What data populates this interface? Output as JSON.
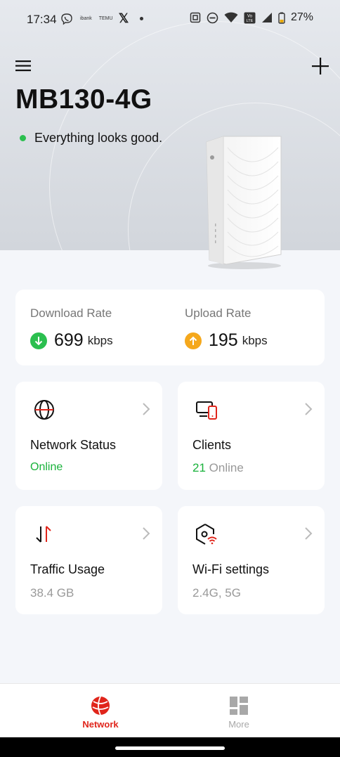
{
  "statusbar": {
    "time": "17:34",
    "notif_ibank": "ibank",
    "notif_temu": "TEMU",
    "notif_x": "𝕏",
    "battery": "27%",
    "volte": "Vo LTE"
  },
  "header": {
    "device_name": "MB130-4G",
    "status_text": "Everything looks good.",
    "status_color": "#2bbf4f"
  },
  "rates": {
    "download": {
      "label": "Download Rate",
      "value": "699",
      "unit": "kbps",
      "color": "#2bbf4f"
    },
    "upload": {
      "label": "Upload Rate",
      "value": "195",
      "unit": "kbps",
      "color": "#f5a81c"
    }
  },
  "tiles": {
    "network_status": {
      "title": "Network Status",
      "sub": "Online",
      "icon": "globe-icon"
    },
    "clients": {
      "title": "Clients",
      "count": "21",
      "sub": "Online",
      "icon": "devices-icon"
    },
    "traffic": {
      "title": "Traffic Usage",
      "sub": "38.4 GB",
      "icon": "traffic-arrows-icon"
    },
    "wifi": {
      "title": "Wi-Fi settings",
      "sub": "2.4G, 5G",
      "icon": "wifi-settings-icon"
    }
  },
  "nav": {
    "network": {
      "label": "Network",
      "color": "#e0251b",
      "active": true
    },
    "more": {
      "label": "More",
      "color": "#a8a8a8",
      "active": false
    }
  }
}
